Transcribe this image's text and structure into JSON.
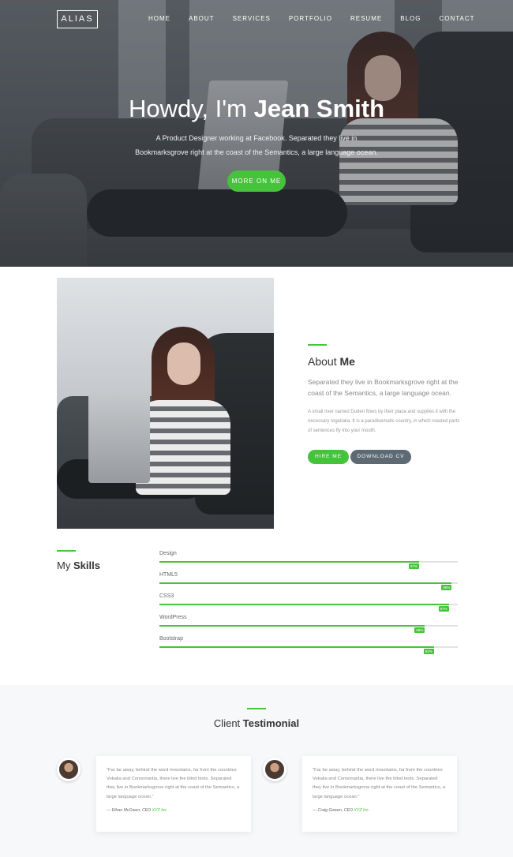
{
  "nav": {
    "logo": "ALIAS",
    "items": [
      "HOME",
      "ABOUT",
      "SERVICES",
      "PORTFOLIO",
      "RESUME",
      "BLOG",
      "CONTACT"
    ]
  },
  "hero": {
    "greeting": "Howdy, I'm",
    "name": "Jean Smith",
    "subtitle": "A Product Designer working at Facebook. Separated they live in Bookmarksgrove right at the coast of the Semantics, a large language ocean.",
    "button": "MORE ON ME"
  },
  "about": {
    "heading_light": "About",
    "heading_bold": "Me",
    "lead": "Separated they live in Bookmarksgrove right at the coast of the Semantics, a large language ocean.",
    "body": "A small river named Duden flows by their place and supplies it with the necessary regelialia. It is a paradisematic country, in which roasted parts of sentences fly into your mouth.",
    "hire_button": "HIRE ME",
    "cv_button": "DOWNLOAD CV"
  },
  "skills": {
    "heading_light": "My",
    "heading_bold": "Skills",
    "items": [
      {
        "name": "Design",
        "percent": 87,
        "label": "87%"
      },
      {
        "name": "HTML5",
        "percent": 98,
        "label": "98%"
      },
      {
        "name": "CSS3",
        "percent": 97,
        "label": "97%"
      },
      {
        "name": "WordPress",
        "percent": 89,
        "label": "89%"
      },
      {
        "name": "Bootstrap",
        "percent": 92,
        "label": "92%"
      }
    ]
  },
  "testimonial": {
    "heading_light": "Client",
    "heading_bold": "Testimonial",
    "cards": [
      {
        "quote": "\"Far far away, behind the word mountains, far from the countries Vokalia and Consonantia, there live the blind texts. Separated they live in Bookmarksgrove right at the coast of the Semantics, a large language ocean.\"",
        "author": "— Ethan McOwen, CEO",
        "company": "XYZ Inc"
      },
      {
        "quote": "\"Far far away, behind the word mountains, far from the countries Vokalia and Consonantia, there live the blind texts. Separated they live in Bookmarksgrove right at the coast of the Semantics, a large language ocean.\"",
        "author": "— Craig Gowen, CEO",
        "company": "XYZ Inc"
      }
    ]
  },
  "colors": {
    "accent": "#45c33a",
    "secondary_button": "#5e6a73"
  }
}
